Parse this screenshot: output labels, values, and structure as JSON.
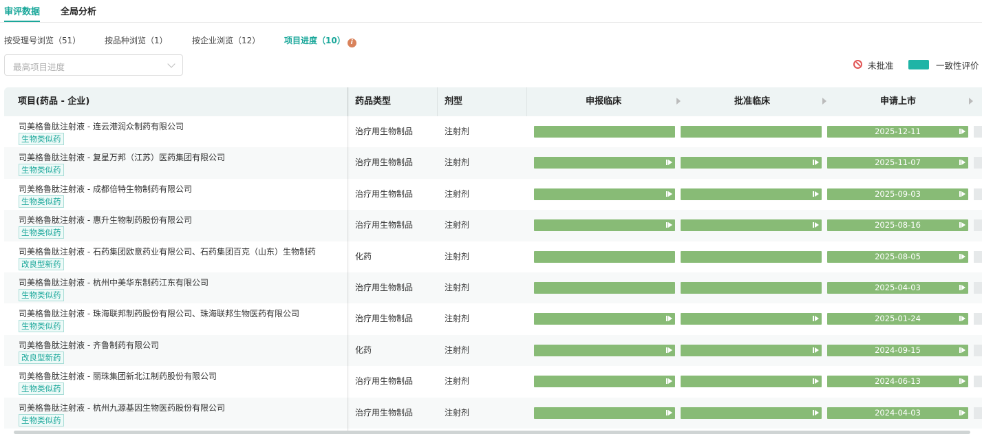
{
  "top_tabs": [
    {
      "label": "审评数据",
      "active": true
    },
    {
      "label": "全局分析",
      "active": false
    }
  ],
  "sub_tabs": [
    {
      "label": "按受理号浏览（51）"
    },
    {
      "label": "按品种浏览（1）"
    },
    {
      "label": "按企业浏览（12）"
    },
    {
      "label": "项目进度（10）",
      "active": true
    }
  ],
  "filter": {
    "placeholder": "最高项目进度"
  },
  "legend": {
    "not_approved": "未批准",
    "consistency": "一致性评价"
  },
  "colors": {
    "accent": "#1aa79a",
    "bar": "#88bb76",
    "legend_swatch": "#1fb4a6",
    "not_approved": "#e05454"
  },
  "table": {
    "headers": {
      "project": "项目(药品 - 企业)",
      "drug_type": "药品类型",
      "form": "剂型",
      "stage1": "申报临床",
      "stage2": "批准临床",
      "stage3": "申请上市"
    },
    "rows": [
      {
        "name": "司美格鲁肽注射液 - 连云港润众制药有限公司",
        "badge": "生物类似药",
        "drug_type": "治疗用生物制品",
        "form": "注射剂",
        "date": "2025-12-11"
      },
      {
        "name": "司美格鲁肽注射液 - 复星万邦（江苏）医药集团有限公司",
        "badge": "生物类似药",
        "drug_type": "治疗用生物制品",
        "form": "注射剂",
        "date": "2025-11-07"
      },
      {
        "name": "司美格鲁肽注射液 - 成都倍特生物制药有限公司",
        "badge": "生物类似药",
        "drug_type": "治疗用生物制品",
        "form": "注射剂",
        "date": "2025-09-03"
      },
      {
        "name": "司美格鲁肽注射液 - 惠升生物制药股份有限公司",
        "badge": "生物类似药",
        "drug_type": "治疗用生物制品",
        "form": "注射剂",
        "date": "2025-08-16"
      },
      {
        "name": "司美格鲁肽注射液 - 石药集团欧意药业有限公司、石药集团百克（山东）生物制药",
        "badge": "改良型新药",
        "drug_type": "化药",
        "form": "注射剂",
        "date": "2025-08-05"
      },
      {
        "name": "司美格鲁肽注射液 - 杭州中美华东制药江东有限公司",
        "badge": "生物类似药",
        "drug_type": "治疗用生物制品",
        "form": "注射剂",
        "date": "2025-04-03"
      },
      {
        "name": "司美格鲁肽注射液 - 珠海联邦制药股份有限公司、珠海联邦生物医药有限公司",
        "badge": "生物类似药",
        "drug_type": "治疗用生物制品",
        "form": "注射剂",
        "date": "2025-01-24"
      },
      {
        "name": "司美格鲁肽注射液 - 齐鲁制药有限公司",
        "badge": "改良型新药",
        "drug_type": "化药",
        "form": "注射剂",
        "date": "2024-09-15"
      },
      {
        "name": "司美格鲁肽注射液 - 丽珠集团新北江制药股份有限公司",
        "badge": "生物类似药",
        "drug_type": "治疗用生物制品",
        "form": "注射剂",
        "date": "2024-06-13"
      },
      {
        "name": "司美格鲁肽注射液 - 杭州九源基因生物医药股份有限公司",
        "badge": "生物类似药",
        "drug_type": "治疗用生物制品",
        "form": "注射剂",
        "date": "2024-04-03"
      }
    ]
  }
}
